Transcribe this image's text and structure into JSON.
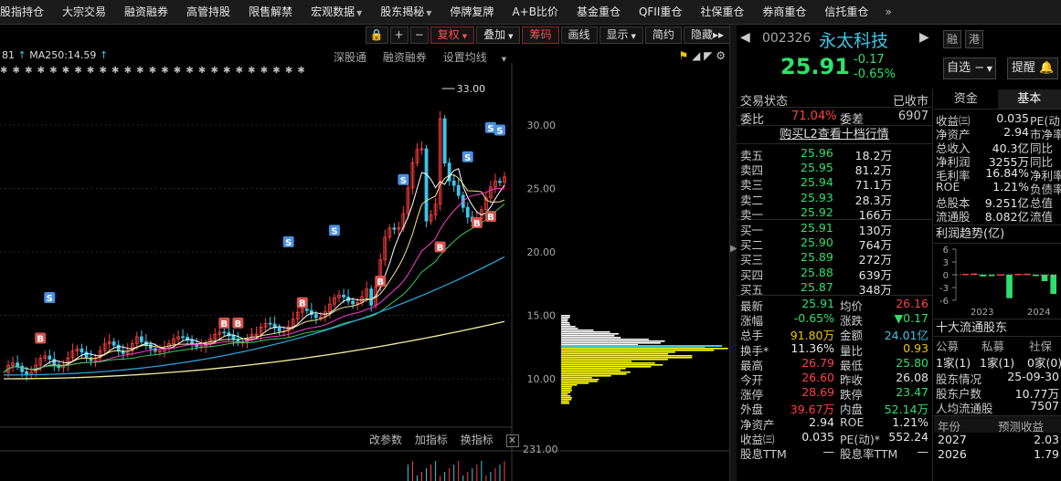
{
  "topbar": {
    "tabs": [
      {
        "label": "股指持仓",
        "caret": false
      },
      {
        "label": "大宗交易",
        "caret": false
      },
      {
        "label": "融资融券",
        "caret": false
      },
      {
        "label": "高管持股",
        "caret": false
      },
      {
        "label": "限售解禁",
        "caret": false
      },
      {
        "label": "宏观数据",
        "caret": true
      },
      {
        "label": "股东揭秘",
        "caret": true
      },
      {
        "label": "停牌复牌",
        "caret": false
      },
      {
        "label": "A+B比价",
        "caret": false
      },
      {
        "label": "基金重仓",
        "caret": false
      },
      {
        "label": "QFII重仓",
        "caret": false
      },
      {
        "label": "社保重仓",
        "caret": false
      },
      {
        "label": "券商重仓",
        "caret": false
      },
      {
        "label": "信托重仓",
        "caret": false
      }
    ],
    "more": "»"
  },
  "chart": {
    "toolbar": {
      "lock": "🔒",
      "plus": "+",
      "minus": "−",
      "fuquan": "复权",
      "diejia": "叠加",
      "chouma": "筹码",
      "huaxian": "画线",
      "xianshi": "显示",
      "jianyue": "简约",
      "yincang": "隐藏",
      "expand": "▸▸",
      "split_icon": "⋮"
    },
    "ma_line": {
      "prefix": "81",
      "ma_label": "MA250:14.59"
    },
    "sublinks": {
      "shengang": "深股通",
      "rzrq": "融资融券",
      "settings": "设置均线"
    },
    "star_row": "✱ ✱ ✱ ✱ ✱ ✱ ✱ ✱ ✱ ✱ ✱ ✱ ✱ ✱ ✱ ✱ ✱ ✱ ✱ ✱ ✱ ✱ ✱ ✱ ✱",
    "high_annotation": "33.00",
    "price_ticks": [
      "30.00",
      "25.00",
      "20.00",
      "15.00",
      "10.00"
    ],
    "indicator_bar": {
      "change_param": "改参数",
      "add_indicator": "加指标",
      "switch_indicator": "换指标",
      "close": "✕"
    },
    "indicator_value": "231.00",
    "colors": {
      "up": "#ff4040",
      "down": "#2ee06a",
      "ma_cyan": "#3ec6e8",
      "ma_yellow": "#f0e68c",
      "ma_magenta": "#ff3dd6",
      "ma_green": "#36d05a",
      "chip_white": "#ffffff",
      "chip_yellow": "#ffff00"
    }
  },
  "stock": {
    "code": "002326",
    "name": "永太科技",
    "tag_rong": "融",
    "tag_gang": "港",
    "price": "25.91",
    "change": "-0.17",
    "change_pct": "-0.65%",
    "watchlist_btn": "自选",
    "watchlist_btn_suffix": "−",
    "remind_btn": "提醒"
  },
  "quote": {
    "status_label": "交易状态",
    "status_value": "已收市",
    "weibi_label": "委比",
    "weibi_value": "71.04%",
    "weicha_label": "委差",
    "weicha_value": "6907",
    "l2_link": "购买L2查看十档行情",
    "sells": [
      {
        "label": "卖五",
        "price": "25.96",
        "vol": "18.2万"
      },
      {
        "label": "卖四",
        "price": "25.95",
        "vol": "81.2万"
      },
      {
        "label": "卖三",
        "price": "25.94",
        "vol": "71.1万"
      },
      {
        "label": "卖二",
        "price": "25.93",
        "vol": "28.3万"
      },
      {
        "label": "卖一",
        "price": "25.92",
        "vol": "166万"
      }
    ],
    "buys": [
      {
        "label": "买一",
        "price": "25.91",
        "vol": "130万"
      },
      {
        "label": "买二",
        "price": "25.90",
        "vol": "764万"
      },
      {
        "label": "买三",
        "price": "25.89",
        "vol": "272万"
      },
      {
        "label": "买四",
        "price": "25.88",
        "vol": "639万"
      },
      {
        "label": "买五",
        "price": "25.87",
        "vol": "348万"
      }
    ],
    "stats": [
      {
        "k1": "最新",
        "v1": "25.91",
        "c1": "green",
        "k2": "均价",
        "v2": "26.16",
        "c2": "red"
      },
      {
        "k1": "涨幅",
        "v1": "-0.65%",
        "c1": "green",
        "k2": "涨跌",
        "v2": "▼0.17",
        "c2": "green"
      },
      {
        "k1": "总手",
        "v1": "91.80万",
        "c1": "yellow",
        "k2": "金额",
        "v2": "24.01亿",
        "c2": "cyan"
      },
      {
        "k1": "换手*",
        "v1": "11.36%",
        "c1": "white",
        "k2": "量比",
        "v2": "0.93",
        "c2": "yellow"
      },
      {
        "k1": "最高",
        "v1": "26.79",
        "c1": "red",
        "k2": "最低",
        "v2": "25.80",
        "c2": "green"
      },
      {
        "k1": "今开",
        "v1": "26.60",
        "c1": "red",
        "k2": "昨收",
        "v2": "26.08",
        "c2": "white"
      },
      {
        "k1": "涨停",
        "v1": "28.69",
        "c1": "red",
        "k2": "跌停",
        "v2": "23.47",
        "c2": "green"
      },
      {
        "k1": "外盘",
        "v1": "39.67万",
        "c1": "red",
        "k2": "内盘",
        "v2": "52.14万",
        "c2": "green"
      },
      {
        "k1": "净资产",
        "v1": "2.94",
        "c1": "white",
        "k2": "ROE",
        "v2": "1.21%",
        "c2": "white"
      },
      {
        "k1": "收益㈢",
        "v1": "0.035",
        "c1": "white",
        "k2": "PE(动)*",
        "v2": "552.24",
        "c2": "white"
      },
      {
        "k1": "股息TTM",
        "v1": "—",
        "c1": "white",
        "k2": "股息率TTM",
        "v2": "—",
        "c2": "white"
      }
    ]
  },
  "fundamentals": {
    "tab_funds": "资金",
    "tab_basic": "基本",
    "rows": [
      {
        "k": "收益㈢",
        "v": "0.035",
        "k2": "PE(动)"
      },
      {
        "k": "净资产",
        "v": "2.94",
        "k2": "市净率"
      },
      {
        "k": "总收入",
        "v": "40.3亿",
        "k2": "同比"
      },
      {
        "k": "净利润",
        "v": "3255万",
        "k2": "同比"
      },
      {
        "k": "毛利率",
        "v": "16.84%",
        "k2": "净利率"
      },
      {
        "k": "ROE",
        "v": "1.21%",
        "k2": "负债率"
      },
      {
        "k": "总股本",
        "v": "9.251亿",
        "k2": "总值"
      },
      {
        "k": "流通股",
        "v": "8.082亿",
        "k2": "流值"
      }
    ],
    "profit_title": "利润趋势(亿)",
    "profit_chart": {
      "y_ticks": [
        "6",
        "3",
        "0",
        "-3",
        "-6"
      ],
      "years": [
        "2023",
        "2024"
      ],
      "values": [
        0.2,
        0.3,
        -0.4,
        -0.2,
        0.1,
        -5.5,
        0.2,
        0.25,
        -0.3,
        -1.5,
        -4.5
      ],
      "ylim": [
        -6,
        6
      ]
    },
    "holders_title": "十大流通股东",
    "holders_cols": [
      "公募",
      "私募",
      "社保"
    ],
    "holders_vals": [
      "1家(1)",
      "1家(1)",
      "0家(0)"
    ],
    "info": [
      {
        "k": "股东情况",
        "v": "25-09-30"
      },
      {
        "k": "股东户数",
        "v": "10.77万"
      },
      {
        "k": "人均流通股",
        "v": "7507"
      }
    ],
    "forecast_cols": [
      "年份",
      "预测收益"
    ],
    "forecast_rows": [
      {
        "year": "2027",
        "eps": "2.03"
      },
      {
        "year": "2026",
        "eps": "1.79"
      }
    ]
  }
}
